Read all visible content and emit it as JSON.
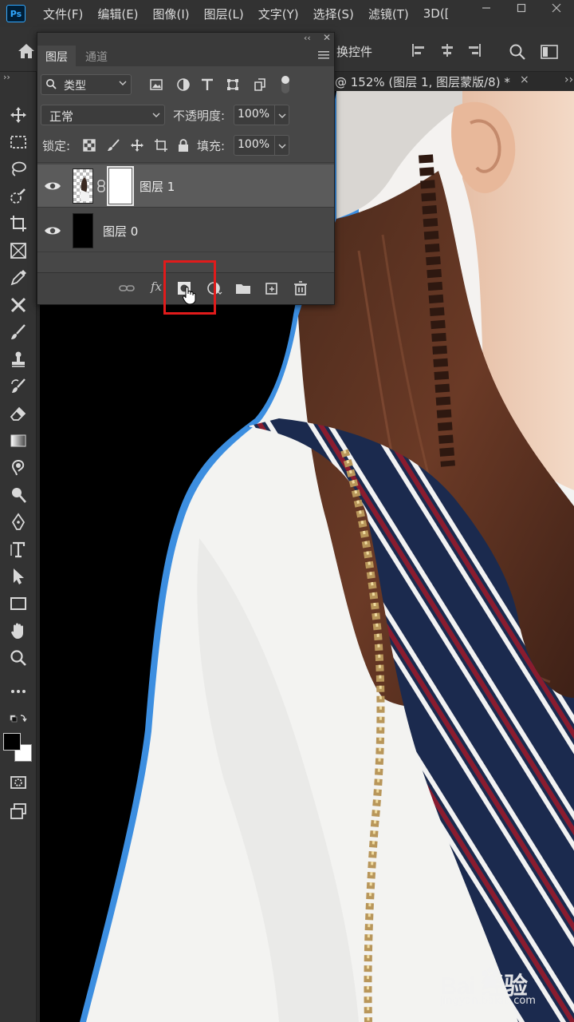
{
  "app": {
    "logo": "Ps",
    "menu": [
      "文件(F)",
      "编辑(E)",
      "图像(I)",
      "图层(L)",
      "文字(Y)",
      "选择(S)",
      "滤镜(T)",
      "3D(["
    ]
  },
  "options_bar": {
    "transform_label": "换控件"
  },
  "document": {
    "tab_title": "@ 152% (图层 1, 图层蒙版/8) *",
    "tab_close": "×",
    "panel_expand": "››"
  },
  "layers_panel": {
    "tabs": [
      "图层",
      "通道"
    ],
    "filter": {
      "label": "类型"
    },
    "blend_mode": "正常",
    "opacity_label": "不透明度:",
    "opacity_value": "100%",
    "lock_label": "锁定:",
    "fill_label": "填充:",
    "fill_value": "100%",
    "layers": [
      {
        "name": "图层 1",
        "visible": true,
        "has_mask": true,
        "selected": true
      },
      {
        "name": "图层 0",
        "visible": true,
        "has_mask": false,
        "selected": false
      }
    ],
    "footer": {
      "fx_label": "fx"
    }
  },
  "watermark": {
    "line1": "Bai  经验",
    "line2": "jingyan.baidu.com"
  },
  "colors": {
    "accent_highlight": "#e01b1b",
    "ps_blue": "#31a8ff",
    "panel_bg": "#474747",
    "selected_layer": "#5b5b5b"
  }
}
